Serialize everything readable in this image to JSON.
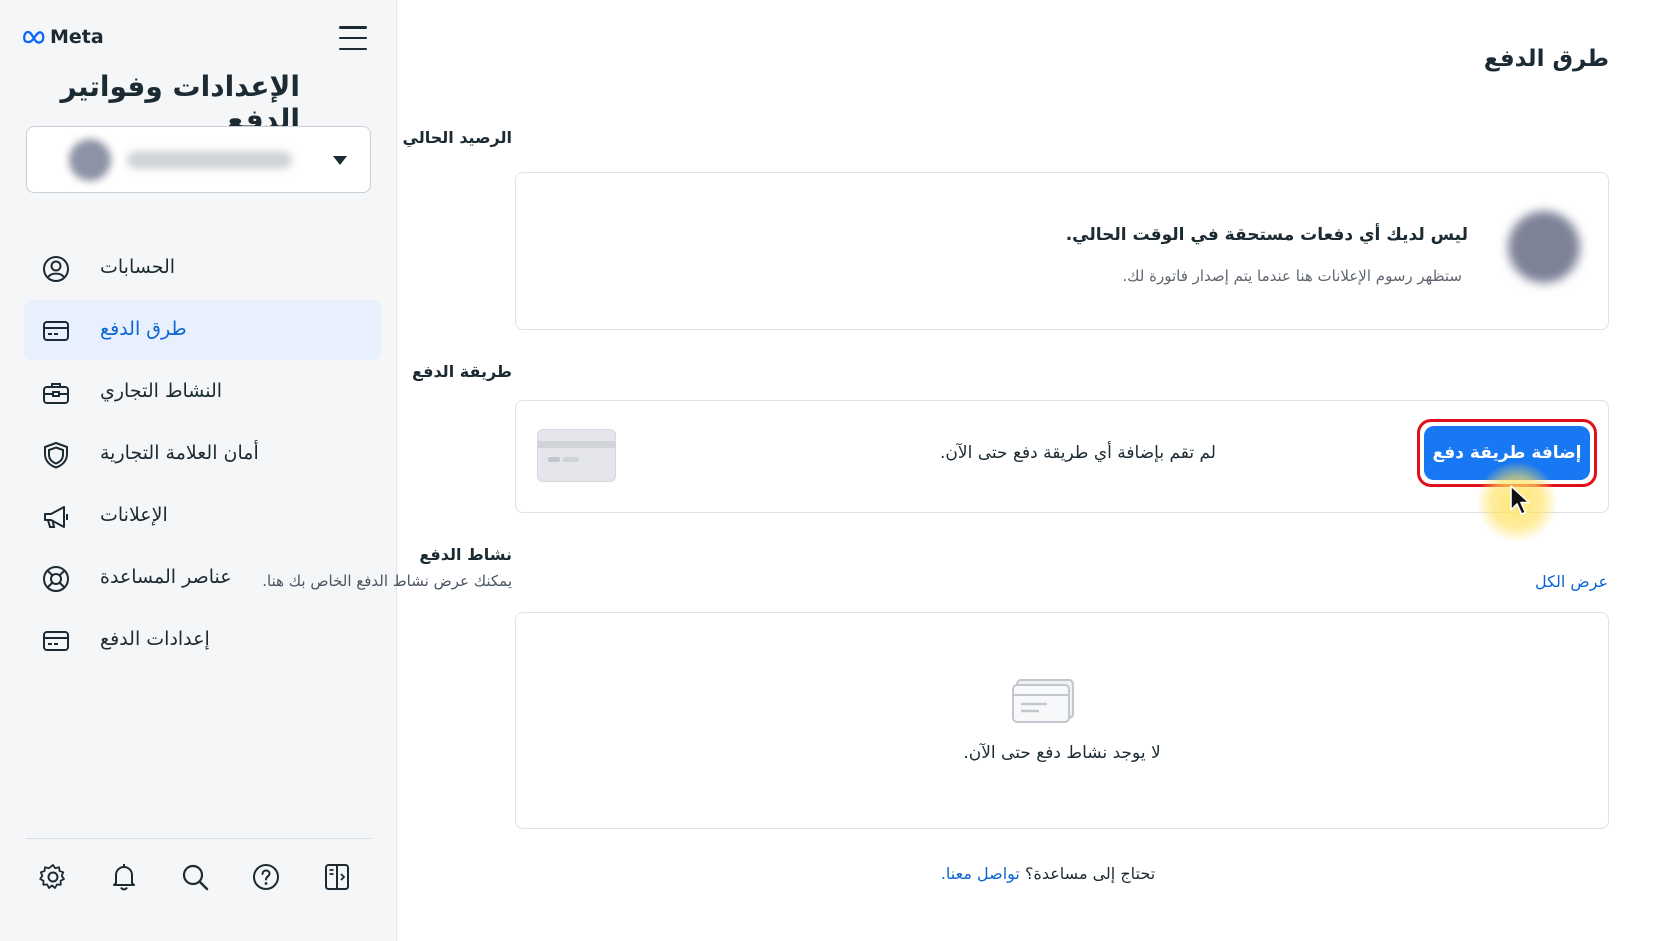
{
  "brand": {
    "name": "Meta"
  },
  "sidebar": {
    "title": "الإعدادات وفواتير الدفع",
    "account_selector": {
      "name": "Redacted account"
    },
    "items": [
      {
        "label": "الحسابات",
        "icon": "user-circle-icon"
      },
      {
        "label": "طرق الدفع",
        "icon": "credit-card-icon",
        "active": true
      },
      {
        "label": "النشاط التجاري",
        "icon": "briefcase-icon"
      },
      {
        "label": "أمان العلامة التجارية",
        "icon": "shield-icon"
      },
      {
        "label": "الإعلانات",
        "icon": "megaphone-icon"
      },
      {
        "label": "عناصر المساعدة",
        "icon": "lifebuoy-icon"
      },
      {
        "label": "إعدادات الدفع",
        "icon": "credit-card-icon"
      }
    ],
    "bottom_icons": [
      "gear-icon",
      "bell-icon",
      "search-icon",
      "help-icon",
      "panel-toggle-icon"
    ]
  },
  "main": {
    "page_title": "طرق الدفع",
    "balance": {
      "label": "الرصيد الحالي",
      "title": "ليس لديك أي دفعات مستحقة في الوقت الحالي.",
      "subtitle": "ستظهر رسوم الإعلانات هنا عندما يتم إصدار فاتورة لك."
    },
    "payment_method": {
      "label": "طريقة الدفع",
      "empty_text": "لم تقم بإضافة أي طريقة دفع حتى الآن.",
      "add_button": "إضافة طريقة دفع"
    },
    "payment_activity": {
      "label": "نشاط الدفع",
      "subtitle": "يمكنك عرض نشاط الدفع الخاص بك هنا.",
      "view_all": "عرض الكل",
      "empty_text": "لا يوجد نشاط دفع حتى الآن."
    },
    "help": {
      "question": "تحتاج إلى مساعدة؟",
      "link": "تواصل معنا."
    }
  },
  "colors": {
    "accent": "#1877f2",
    "link": "#0a66d4",
    "active_bg": "#e7f0fc",
    "highlight_ring": "#e0101a",
    "sidebar_bg": "#f5f6f7"
  }
}
